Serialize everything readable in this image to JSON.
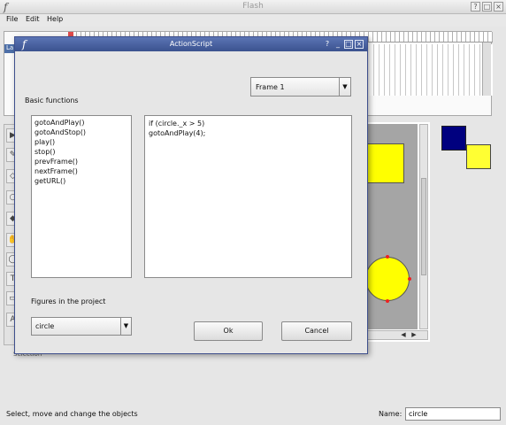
{
  "app": {
    "title": "Flash",
    "logo": "f",
    "window_buttons": [
      "?",
      "□",
      "×"
    ]
  },
  "menu": [
    "File",
    "Edit",
    "Help"
  ],
  "timeline": {
    "layers_label": "La"
  },
  "toolbar": {
    "tools": [
      "select-tool",
      "pen-tool",
      "shape-tool",
      "circle-tool",
      "fill-tool",
      "hand-tool",
      "zoom-tool",
      "text-tool",
      "image-tool",
      "play-tool"
    ],
    "selection_label": "Selection"
  },
  "stage": {
    "colors": {
      "stage": "#a5a5a5",
      "rect": "#ffff00",
      "circle": "#ffff00"
    }
  },
  "swatches": {
    "stroke": "#00007f",
    "fill": "#ffff33"
  },
  "statusbar": {
    "message": "Select, move and change the objects",
    "name_label": "Name:",
    "name_value": "circle"
  },
  "dialog": {
    "title": "ActionScript",
    "logo": "f",
    "buttons": [
      "?",
      "_",
      "□",
      "×"
    ],
    "frame_select": "Frame 1",
    "basic_functions_label": "Basic functions",
    "functions": [
      "gotoAndPlay()",
      "gotoAndStop()",
      "play()",
      "stop()",
      "prevFrame()",
      "nextFrame()",
      "getURL()"
    ],
    "code_lines": [
      "if (circle._x > 5)",
      "gotoAndPlay(4);"
    ],
    "figures_label": "Figures in the project",
    "figure_select": "circle",
    "ok_label": "Ok",
    "cancel_label": "Cancel"
  }
}
